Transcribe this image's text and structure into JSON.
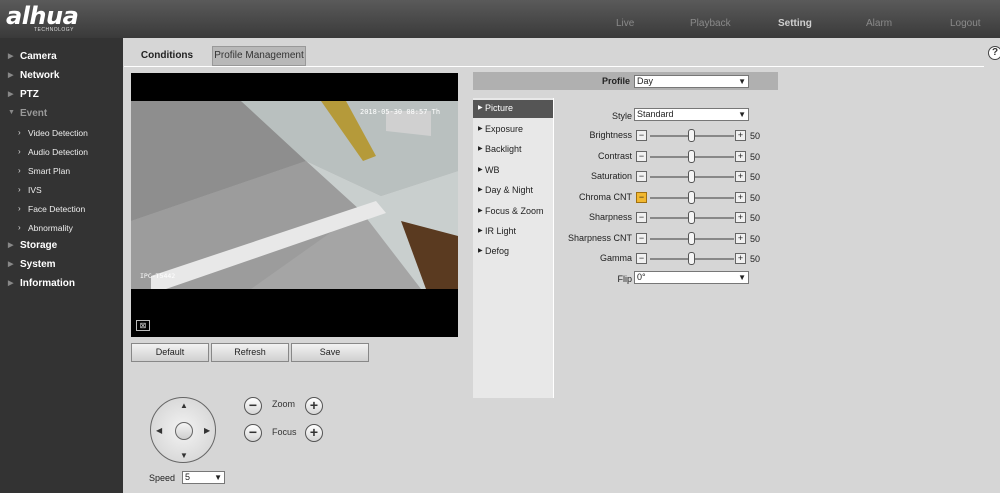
{
  "header": {
    "logo": "alhua",
    "logo_sub": "TECHNOLOGY",
    "nav": [
      "Live",
      "Playback",
      "Setting",
      "Alarm",
      "Logout"
    ]
  },
  "sidebar": {
    "items": [
      {
        "label": "Camera"
      },
      {
        "label": "Network"
      },
      {
        "label": "PTZ"
      },
      {
        "label": "Event"
      },
      {
        "label": "Video Detection"
      },
      {
        "label": "Audio Detection"
      },
      {
        "label": "Smart Plan"
      },
      {
        "label": "IVS"
      },
      {
        "label": "Face Detection"
      },
      {
        "label": "Abnormality"
      },
      {
        "label": "Storage"
      },
      {
        "label": "System"
      },
      {
        "label": "Information"
      }
    ]
  },
  "tabs": {
    "conditions": "Conditions",
    "profile_management": "Profile Management"
  },
  "video": {
    "osd_top": "2018-05-30 08:57 Th",
    "osd_bottom": "IPC-T5442"
  },
  "buttons": {
    "default": "Default",
    "refresh": "Refresh",
    "save": "Save"
  },
  "ptz": {
    "zoom_label": "Zoom",
    "focus_label": "Focus",
    "speed_label": "Speed",
    "speed_value": "5"
  },
  "profile": {
    "label": "Profile",
    "value": "Day"
  },
  "menu": [
    "Picture",
    "Exposure",
    "Backlight",
    "WB",
    "Day & Night",
    "Focus & Zoom",
    "IR Light",
    "Defog"
  ],
  "settings": {
    "style_label": "Style",
    "style_value": "Standard",
    "sliders": [
      {
        "label": "Brightness",
        "value": "50"
      },
      {
        "label": "Contrast",
        "value": "50"
      },
      {
        "label": "Saturation",
        "value": "50"
      },
      {
        "label": "Chroma CNT",
        "value": "50"
      },
      {
        "label": "Sharpness",
        "value": "50"
      },
      {
        "label": "Sharpness CNT",
        "value": "50"
      },
      {
        "label": "Gamma",
        "value": "50"
      }
    ],
    "flip_label": "Flip",
    "flip_value": "0°"
  }
}
